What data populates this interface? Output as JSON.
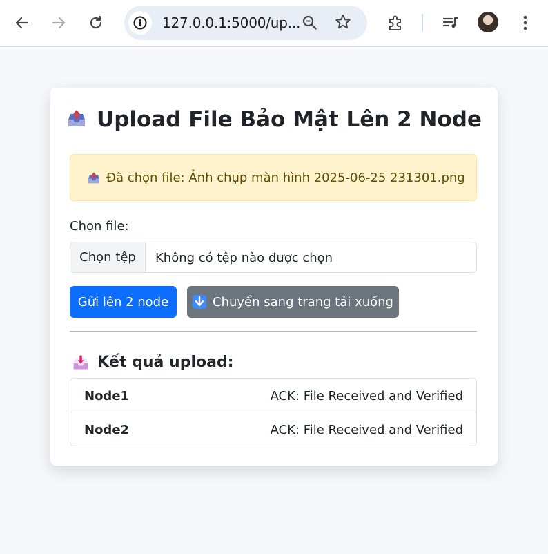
{
  "browser": {
    "url": "127.0.0.1:5000/up...",
    "icons": [
      "back-icon",
      "forward-icon",
      "reload-icon",
      "site-info-icon",
      "zoom-icon",
      "star-icon",
      "extensions-icon",
      "media-icon",
      "profile-avatar",
      "menu-icon"
    ]
  },
  "page": {
    "title": "Upload File Bảo Mật Lên 2 Node",
    "title_icon": "outbox-tray-icon",
    "alert": {
      "icon": "outbox-tray-icon",
      "text": "Đã chọn file: Ảnh chụp màn hình 2025-06-25 231301.png"
    },
    "file_label": "Chọn file:",
    "file_input": {
      "button_label": "Chọn tệp",
      "status": "Không có tệp nào được chọn"
    },
    "submit_label": "Gửi lên 2 node",
    "download_label": "Chuyển sang trang tải xuống",
    "download_icon": "down-arrow-icon",
    "results": {
      "icon": "inbox-tray-icon",
      "title": "Kết quả upload:",
      "rows": [
        {
          "node": "Node1",
          "status": "ACK: File Received and Verified"
        },
        {
          "node": "Node2",
          "status": "ACK: File Received and Verified"
        }
      ]
    }
  },
  "colors": {
    "primary": "#0d6efd",
    "secondary": "#6c757d",
    "alert_bg": "#fff3cd",
    "alert_text": "#664d03",
    "page_bg": "#f5f7fa"
  }
}
